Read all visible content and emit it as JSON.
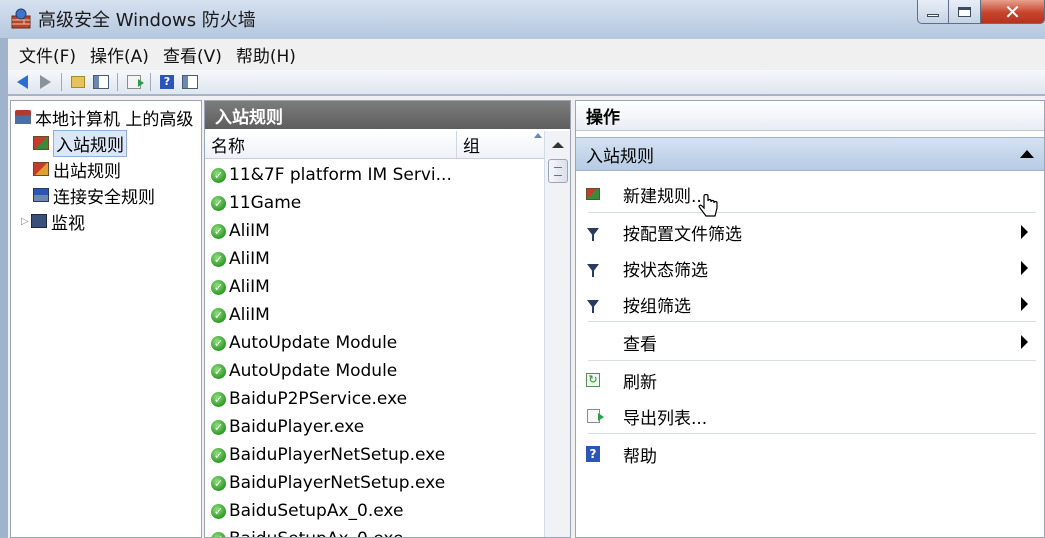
{
  "window": {
    "title": "高级安全 Windows 防火墙",
    "close_glyph": "✕"
  },
  "menu": [
    "文件(F)",
    "操作(A)",
    "查看(V)",
    "帮助(H)"
  ],
  "toolbar": {
    "help_glyph": "?"
  },
  "tree": {
    "root": "本地计算机 上的高级",
    "items": [
      {
        "label": "入站规则",
        "icon": "inbound-rules-icon",
        "selected": true
      },
      {
        "label": "出站规则",
        "icon": "outbound-rules-icon"
      },
      {
        "label": "连接安全规则",
        "icon": "connection-security-icon"
      },
      {
        "label": "监视",
        "icon": "monitor-icon",
        "expander": "▷"
      }
    ]
  },
  "rules_pane": {
    "header": "入站规则",
    "columns": {
      "name": "名称",
      "group": "组"
    },
    "check_glyph": "✓",
    "rules": [
      "11&7F platform IM Servi...",
      "11Game",
      "AliIM",
      "AliIM",
      "AliIM",
      "AliIM",
      "AutoUpdate Module",
      "AutoUpdate Module",
      "BaiduP2PService.exe",
      "BaiduPlayer.exe",
      "BaiduPlayerNetSetup.exe",
      "BaiduPlayerNetSetup.exe",
      "BaiduSetupAx_0.exe",
      "BaiduSetupAx_0.exe"
    ]
  },
  "actions_pane": {
    "header": "操作",
    "section": "入站规则",
    "refresh_glyph": "↻",
    "help_glyph": "?",
    "items": [
      {
        "label": "新建规则...",
        "icon": "new-rule-icon"
      },
      {
        "label": "按配置文件筛选",
        "icon": "filter-icon",
        "submenu": true
      },
      {
        "label": "按状态筛选",
        "icon": "filter-icon",
        "submenu": true
      },
      {
        "label": "按组筛选",
        "icon": "filter-icon",
        "submenu": true
      },
      {
        "label": "查看",
        "icon": "",
        "submenu": true
      },
      {
        "label": "刷新",
        "icon": "refresh-icon"
      },
      {
        "label": "导出列表...",
        "icon": "export-icon"
      },
      {
        "label": "帮助",
        "icon": "help-icon"
      }
    ]
  },
  "colors": {
    "title_bar": "#c2d2e6",
    "pane_header_dark": "#6a6a6a",
    "section_header": "#c6d7ec",
    "check_green": "#2f9a2a"
  }
}
